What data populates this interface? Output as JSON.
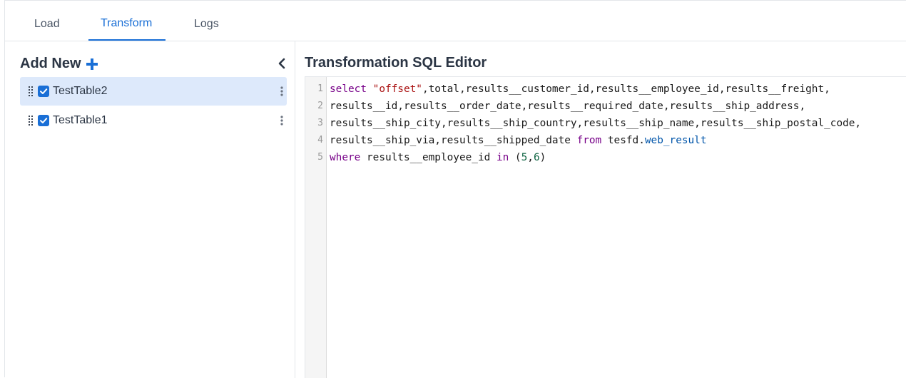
{
  "tabs": [
    {
      "label": "Load",
      "active": false
    },
    {
      "label": "Transform",
      "active": true
    },
    {
      "label": "Logs",
      "active": false
    }
  ],
  "sidebar": {
    "add_new_label": "Add New",
    "add_icon": "plus-icon",
    "collapse_icon": "chevron-left-icon",
    "items": [
      {
        "label": "TestTable2",
        "checked": true,
        "selected": true
      },
      {
        "label": "TestTable1",
        "checked": true,
        "selected": false
      }
    ]
  },
  "editor": {
    "title": "Transformation SQL Editor",
    "line_numbers": [
      "1",
      "2",
      "3",
      "4",
      "5"
    ],
    "lines": [
      "select \"offset\",total,results__customer_id,results__employee_id,results__freight,",
      "results__id,results__order_date,results__required_date,results__ship_address,",
      "results__ship_city,results__ship_country,results__ship_name,results__ship_postal_code,",
      "results__ship_via,results__shipped_date from tesfd.web_result",
      "where results__employee_id in (5,6)"
    ],
    "tokens": {
      "l1_kw": "select",
      "l1_str": "\"offset\"",
      "l1_rest": ",total,results__customer_id,results__employee_id,results__freight,",
      "l4_a": "results__ship_via,results__shipped_date ",
      "l4_kw": "from",
      "l4_b": " tesfd.",
      "l4_prop": "web_result",
      "l5_kw1": "where",
      "l5_a": " results__employee_id ",
      "l5_kw2": "in",
      "l5_b": " (",
      "l5_n1": "5",
      "l5_c": ",",
      "l5_n2": "6",
      "l5_d": ")"
    }
  },
  "colors": {
    "accent": "#1a6fd6",
    "selected_row": "#dde9fb",
    "keyword": "#770088",
    "string": "#aa1111",
    "number": "#116644"
  }
}
